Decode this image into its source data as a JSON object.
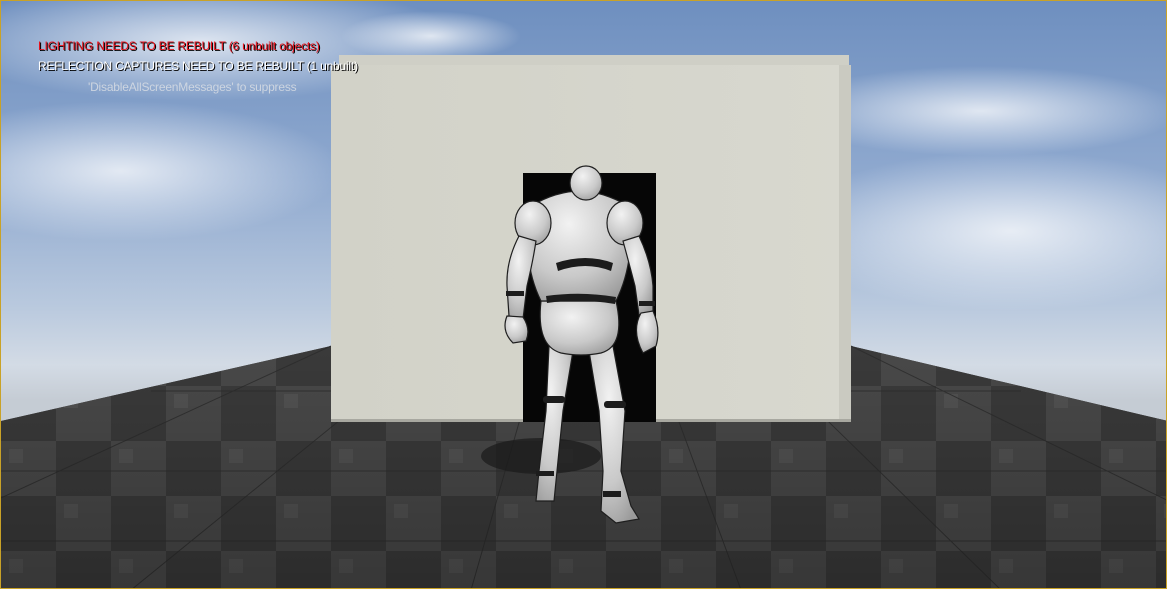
{
  "viewport": {
    "border_color": "#c9a227",
    "messages": {
      "lighting": "LIGHTING NEEDS TO BE REBUILT (6 unbuilt objects)",
      "lighting_color": "#e8141e",
      "reflection": "REFLECTION CAPTURES NEED TO BE REBUILT (1 unbuilt)",
      "suppress": "'DisableAllScreenMessages' to suppress"
    }
  },
  "scene": {
    "floor": "checkered-floor",
    "wall": "door-wall",
    "character": "mannequin"
  }
}
